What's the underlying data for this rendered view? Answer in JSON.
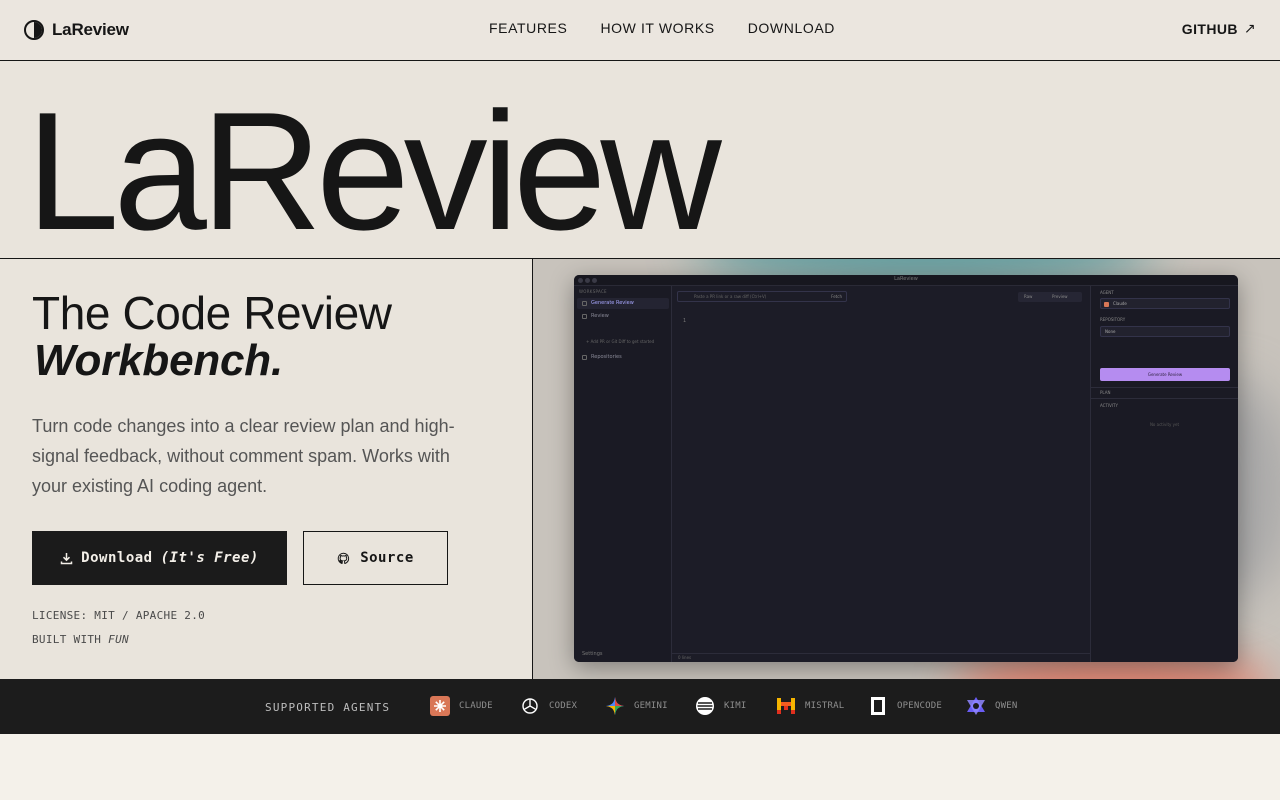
{
  "nav": {
    "brand": "LaReview",
    "links": [
      "FEATURES",
      "HOW IT WORKS",
      "DOWNLOAD"
    ],
    "github": "GITHUB",
    "github_icon": "arrow-up-right-icon"
  },
  "hero": {
    "title": "LaReview",
    "headline": "The Code Review",
    "headline_emphasis": "Workbench.",
    "subtext": "Turn code changes into a clear review plan and high-signal feedback, without comment spam. Works with your existing AI coding agent.",
    "download_label": "Download",
    "download_free": "(It's Free)",
    "source_label": "Source",
    "license": "LICENSE: MIT / APACHE 2.0",
    "built_with": "BUILT WITH",
    "built_with_word": "FUN"
  },
  "app_preview": {
    "window_title": "LaReview",
    "sidebar_header": "WORKSPACE",
    "sidebar_items": [
      "Generate Review",
      "Review",
      "Repositories"
    ],
    "sidebar_sub": "+ Add PR or Git Diff to get started",
    "settings": "Settings",
    "input_placeholder": "Paste a PR link or a raw diff (Ctrl+V)",
    "fetch": "Fetch",
    "toggle": [
      "Raw",
      "Preview"
    ],
    "line_number": "1",
    "footer": "0 lines",
    "agent_label": "AGENT",
    "agent_value": "Claude",
    "repo_label": "REPOSITORY",
    "repo_value": "None",
    "generate_button": "Generate Review",
    "plan_label": "PLAN",
    "activity_label": "ACTIVITY",
    "empty": "No activity yet"
  },
  "agents": {
    "label": "SUPPORTED AGENTS",
    "items": [
      {
        "name": "CLAUDE",
        "icon": "claude-icon",
        "color": "#d97757"
      },
      {
        "name": "CODEX",
        "icon": "openai-icon",
        "color": "#ffffff"
      },
      {
        "name": "GEMINI",
        "icon": "gemini-icon",
        "color": "#4e86f5"
      },
      {
        "name": "KIMI",
        "icon": "kimi-icon",
        "color": "#ffffff"
      },
      {
        "name": "MISTRAL",
        "icon": "mistral-icon",
        "color": "#f25c1f"
      },
      {
        "name": "OPENCODE",
        "icon": "opencode-icon",
        "color": "#ffffff"
      },
      {
        "name": "QWEN",
        "icon": "qwen-icon",
        "color": "#6a5df5"
      }
    ]
  },
  "colors": {
    "background": "#f4f1ea",
    "panel": "#e9e4dc",
    "ink": "#161616",
    "accent_purple": "#b58cf0"
  }
}
